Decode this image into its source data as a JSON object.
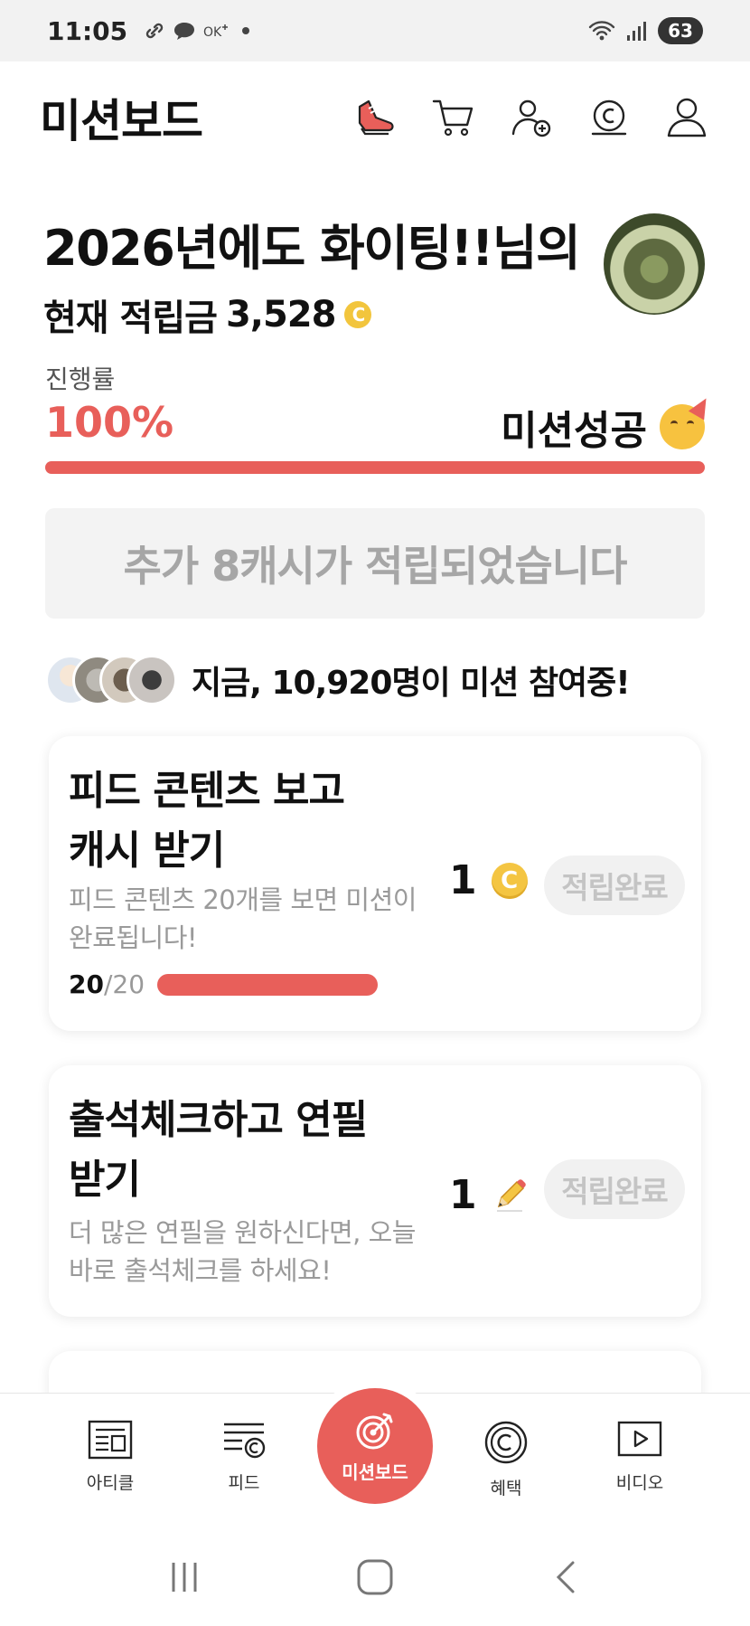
{
  "status_bar": {
    "time": "11:05",
    "left_icons": [
      "link-icon",
      "chat-bubble-icon",
      "ok-icon",
      "dot-icon"
    ],
    "right_icons": [
      "wifi-icon",
      "signal-icon"
    ],
    "battery": "63"
  },
  "header": {
    "title": "미션보드",
    "icons": [
      "sneaker-icon",
      "cart-icon",
      "add-friend-icon",
      "cash-coin-icon",
      "profile-icon"
    ]
  },
  "greeting": {
    "name_line": "2026년에도 화이팅!!님의",
    "balance_label": "현재 적립금",
    "balance_value": "3,528",
    "coin_symbol": "C"
  },
  "progress": {
    "label": "진행률",
    "percent_text": "100%",
    "percent_value": 1.0,
    "status": "미션성공"
  },
  "banner": {
    "text": "추가 8캐시가 적립되었습니다"
  },
  "participants": {
    "prefix": "지금,",
    "count": "10,920명",
    "suffix": "이 미션 참여중!"
  },
  "missions": [
    {
      "title_line1": "피드 콘텐츠 보고",
      "title_line2": "캐시 받기",
      "description": "피드 콘텐츠 20개를 보면 미션이 완료됩니다!",
      "reward_amount": "1",
      "reward_icon": "coin-icon",
      "button": "적립완료",
      "progress_current": "20",
      "progress_total": "/20",
      "progress_value": 1.0
    },
    {
      "title_line1": "출석체크하고 연필",
      "title_line2": "받기",
      "description": "더 많은 연필을 원하신다면, 오늘 바로 출석체크를 하세요!",
      "reward_amount": "1",
      "reward_icon": "pencil-icon",
      "button": "적립완료"
    }
  ],
  "bottom_nav": {
    "items": [
      {
        "label": "아티클",
        "icon": "article-icon"
      },
      {
        "label": "피드",
        "icon": "feed-icon"
      },
      {
        "label": "미션보드",
        "icon": "target-icon"
      },
      {
        "label": "혜택",
        "icon": "benefit-coin-icon"
      },
      {
        "label": "비디오",
        "icon": "video-icon"
      }
    ]
  },
  "colors": {
    "accent": "#e85f5a",
    "coin": "#f4c542",
    "muted_text": "#9a9a9a",
    "banner_bg": "#f3f3f3"
  }
}
